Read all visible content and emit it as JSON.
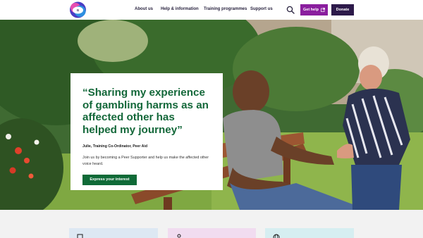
{
  "header": {
    "logo_icon": "gamcare-logo-icon",
    "nav": [
      "About us",
      "Help & information",
      "Training programmes",
      "Support us"
    ],
    "search_icon": "search-icon",
    "get_help_label": "Get help",
    "external_icon": "external-link-icon",
    "donate_label": "Donate",
    "colors": {
      "get_help_bg": "#8a1e9e",
      "donate_bg": "#2d1a4a"
    }
  },
  "hero": {
    "quote": "“Sharing my experience of gambling harms as an affected other has helped my journey”",
    "attribution": "Julie, Training Co-Ordinator, Peer Aid",
    "body": "Join us by becoming a Peer Supporter and help us make the affected other voice heard.",
    "cta_label": "Express your interest",
    "colors": {
      "quote": "#14683a",
      "cta_bg": "#0f6a37"
    }
  },
  "cards": [
    {
      "icon": "laptop-icon",
      "color": "#dde8f3"
    },
    {
      "icon": "person-icon",
      "color": "#f1dcf0"
    },
    {
      "icon": "globe-icon",
      "color": "#d6eef1"
    }
  ]
}
